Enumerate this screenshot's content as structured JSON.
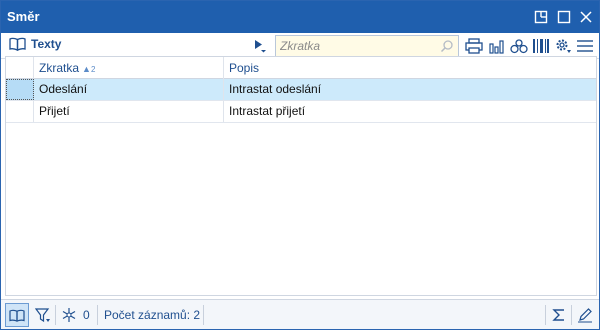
{
  "window": {
    "title": "Směr"
  },
  "toolbar": {
    "texty_label": "Texty",
    "search_placeholder": "Zkratka"
  },
  "grid": {
    "columns": [
      {
        "label": "Zkratka",
        "sort": "ascending",
        "sort_order": "2"
      },
      {
        "label": "Popis"
      }
    ],
    "rows": [
      {
        "zkratka": "Odeslání",
        "popis": "Intrastat odeslání",
        "selected": true
      },
      {
        "zkratka": "Přijetí",
        "popis": "Intrastat přijetí",
        "selected": false
      }
    ]
  },
  "statusbar": {
    "snowflake_count": "0",
    "record_count_label": "Počet záznamů: 2"
  },
  "colors": {
    "titlebar": "#1f5fae",
    "selected_row": "#cdeafb",
    "accent_text": "#1f4f8f",
    "search_bg": "#fffbe6"
  },
  "icons": [
    "book-icon",
    "play-menu-icon",
    "search-icon",
    "printer-icon",
    "chart-icon",
    "bicycle-icon",
    "barcode-icon",
    "gear-icon",
    "hamburger-menu-icon",
    "filter-icon",
    "snowflake-icon",
    "sigma-icon",
    "pencil-icon",
    "restore-icon",
    "maximize-icon",
    "close-icon"
  ]
}
